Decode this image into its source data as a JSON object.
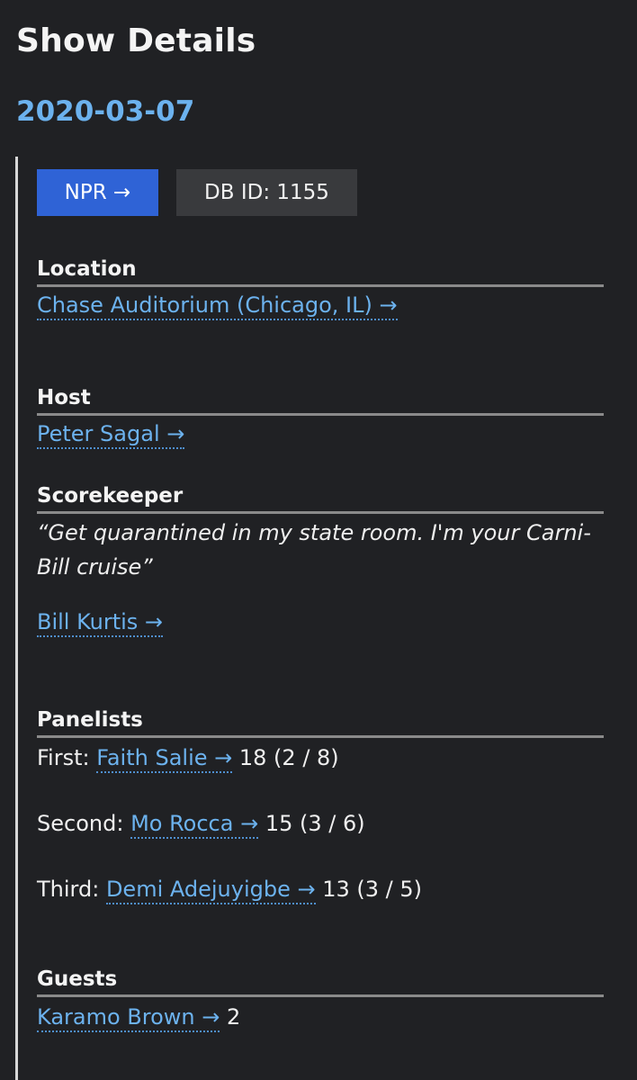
{
  "page": {
    "title": "Show Details",
    "date": "2020-03-07"
  },
  "actions": {
    "npr_label": "NPR →",
    "db_id_label": "DB ID: 1155"
  },
  "location": {
    "heading": "Location",
    "name": "Chase Auditorium (Chicago, IL) →"
  },
  "host": {
    "heading": "Host",
    "name": "Peter Sagal →"
  },
  "scorekeeper": {
    "heading": "Scorekeeper",
    "quote_line1": "“Get quarantined in my state room. I'm your Carni-",
    "quote_line2": "Bill cruise”",
    "name": "Bill Kurtis →"
  },
  "panelists": {
    "heading": "Panelists",
    "items": [
      {
        "position": "First:",
        "name": "Faith Salie →",
        "score": "18 (2 / 8)"
      },
      {
        "position": "Second:",
        "name": "Mo Rocca →",
        "score": "15 (3 / 6)"
      },
      {
        "position": "Third:",
        "name": "Demi Adejuyigbe →",
        "score": "13 (3 / 5)"
      }
    ]
  },
  "guests": {
    "heading": "Guests",
    "items": [
      {
        "name": "Karamo Brown →",
        "score": "2"
      }
    ]
  }
}
